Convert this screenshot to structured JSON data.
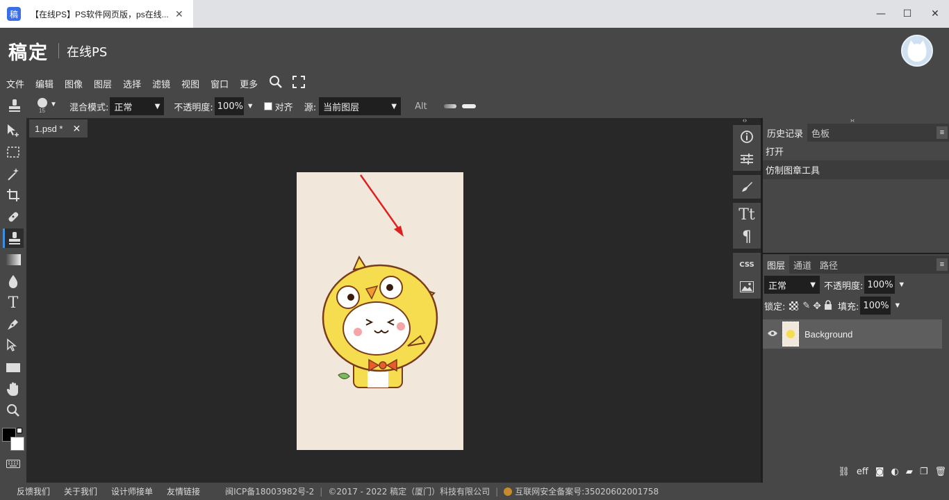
{
  "browser": {
    "tab_title": "【在线PS】PS软件网页版，ps在线...",
    "favicon_text": "稿",
    "tab_close": "✕",
    "minimize": "—",
    "maximize": "☐",
    "close": "✕"
  },
  "header": {
    "logo": "稿定",
    "subtitle": "在线PS"
  },
  "menu": {
    "items": [
      "文件",
      "编辑",
      "图像",
      "图层",
      "选择",
      "滤镜",
      "视图",
      "窗口",
      "更多"
    ]
  },
  "options": {
    "brush_size": "15",
    "blend_label": "混合模式:",
    "blend_value": "正常",
    "opacity_label": "不透明度:",
    "opacity_value": "100%",
    "align_label": "对齐",
    "source_label": "源:",
    "source_value": "当前图层",
    "alt_label": "Alt"
  },
  "document": {
    "tab_label": "1.psd *",
    "tab_close": "✕",
    "background_color": "#f1e7db"
  },
  "history_panel": {
    "tabs": [
      "历史记录",
      "色板"
    ],
    "items": [
      "打开",
      "仿制图章工具"
    ],
    "menu": "≡"
  },
  "layers_panel": {
    "tabs": [
      "图层",
      "通道",
      "路径"
    ],
    "menu": "≡",
    "blend_value": "正常",
    "opacity_label": "不透明度:",
    "opacity_value": "100%",
    "lock_label": "锁定:",
    "fill_label": "填充:",
    "fill_value": "100%",
    "layers": [
      {
        "name": "Background"
      }
    ],
    "footer_text": "eff"
  },
  "footer": {
    "links": [
      "反馈我们",
      "关于我们",
      "设计师接单",
      "友情链接"
    ],
    "icp": "闽ICP备18003982号-2",
    "copyright": "©2017 - 2022 稿定（厦门）科技有限公司",
    "security": "互联网安全备案号:35020602001758"
  },
  "colors": {
    "accent": "#3d8fe0",
    "panel": "#474747",
    "canvas_bg": "#282828",
    "arrow": "#e02020"
  }
}
